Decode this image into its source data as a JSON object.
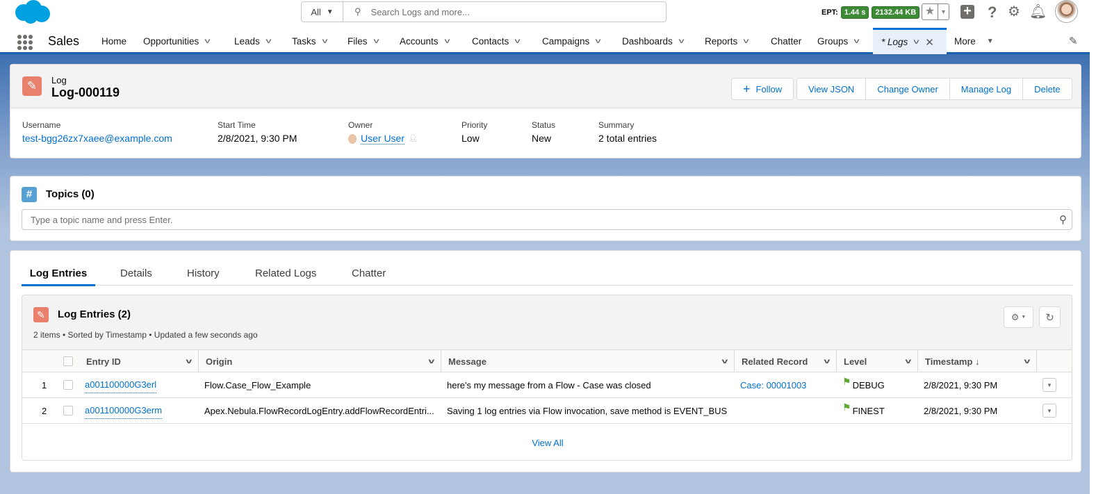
{
  "header": {
    "search_scope": "All",
    "search_placeholder": "Search Logs and more...",
    "ept_label": "EPT:",
    "ept_time": "1.44 s",
    "ept_size": "2132.44 KB"
  },
  "nav": {
    "app_name": "Sales",
    "items": [
      {
        "label": "Home"
      },
      {
        "label": "Opportunities"
      },
      {
        "label": "Leads"
      },
      {
        "label": "Tasks"
      },
      {
        "label": "Files"
      },
      {
        "label": "Accounts"
      },
      {
        "label": "Contacts"
      },
      {
        "label": "Campaigns"
      },
      {
        "label": "Dashboards"
      },
      {
        "label": "Reports"
      },
      {
        "label": "Chatter"
      },
      {
        "label": "Groups"
      }
    ],
    "active_tab": "* Logs",
    "more": "More"
  },
  "record": {
    "object": "Log",
    "name": "Log-000119",
    "buttons": {
      "follow": "Follow",
      "view_json": "View JSON",
      "change_owner": "Change Owner",
      "manage_log": "Manage Log",
      "delete": "Delete"
    },
    "fields": [
      {
        "label": "Username",
        "value": "test-bgg26zx7xaee@example.com"
      },
      {
        "label": "Start Time",
        "value": "2/8/2021, 9:30 PM"
      },
      {
        "label": "Owner",
        "value": "User User"
      },
      {
        "label": "Priority",
        "value": "Low"
      },
      {
        "label": "Status",
        "value": "New"
      },
      {
        "label": "Summary",
        "value": "2 total entries"
      }
    ]
  },
  "topics": {
    "title": "Topics (0)",
    "placeholder": "Type a topic name and press Enter."
  },
  "tabs": [
    "Log Entries",
    "Details",
    "History",
    "Related Logs",
    "Chatter"
  ],
  "entries": {
    "title": "Log Entries (2)",
    "meta": "2 items • Sorted by Timestamp • Updated a few seconds ago",
    "columns": [
      "Entry ID",
      "Origin",
      "Message",
      "Related Record",
      "Level",
      "Timestamp ↓"
    ],
    "rows": [
      {
        "num": "1",
        "id": "a001100000G3erl",
        "origin": "Flow.Case_Flow_Example",
        "message": "here's my message from a Flow - Case was closed",
        "related": "Case: 00001003",
        "level": "DEBUG",
        "timestamp": "2/8/2021, 9:30 PM"
      },
      {
        "num": "2",
        "id": "a001100000G3erm",
        "origin": "Apex.Nebula.FlowRecordLogEntry.addFlowRecordEntri...",
        "message": "Saving 1 log entries via Flow invocation, save method is EVENT_BUS",
        "related": "",
        "level": "FINEST",
        "timestamp": "2/8/2021, 9:30 PM"
      }
    ],
    "view_all": "View All"
  },
  "colors": {
    "brand": "#0070d2",
    "log_icon": "#e8806c",
    "topics_icon": "#56a0d3",
    "badge": "#3d8b37"
  }
}
